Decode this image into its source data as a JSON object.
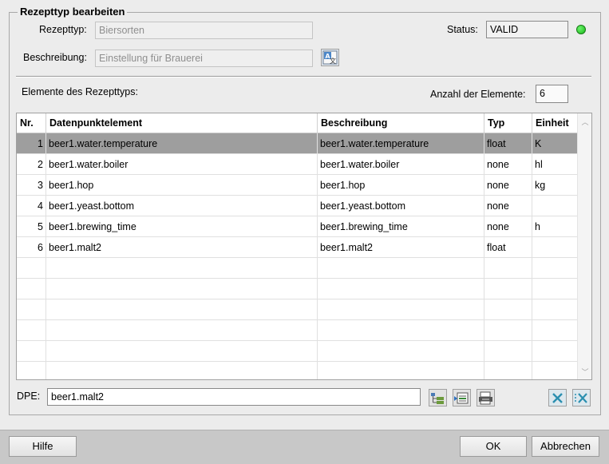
{
  "title": "Rezepttyp bearbeiten",
  "form": {
    "rezepttyp_label": "Rezepttyp:",
    "rezepttyp_value": "Biersorten",
    "beschreibung_label": "Beschreibung:",
    "beschreibung_value": "Einstellung für Brauerei",
    "status_label": "Status:",
    "status_value": "VALID",
    "status_color": "#22c322"
  },
  "elements": {
    "label": "Elemente des Rezepttyps:",
    "count_label": "Anzahl der Elemente:",
    "count_value": "6"
  },
  "table": {
    "headers": [
      "Nr.",
      "Datenpunktelement",
      "Beschreibung",
      "Typ",
      "Einheit"
    ],
    "rows": [
      [
        "1",
        "beer1.water.temperature",
        "beer1.water.temperature",
        "float",
        "K"
      ],
      [
        "2",
        "beer1.water.boiler",
        "beer1.water.boiler",
        "none",
        "hl"
      ],
      [
        "3",
        "beer1.hop",
        "beer1.hop",
        "none",
        "kg"
      ],
      [
        "4",
        "beer1.yeast.bottom",
        "beer1.yeast.bottom",
        "none",
        ""
      ],
      [
        "5",
        "beer1.brewing_time",
        "beer1.brewing_time",
        "none",
        "h"
      ],
      [
        "6",
        "beer1.malt2",
        "beer1.malt2",
        "float",
        ""
      ]
    ],
    "selected_row": 0,
    "empty_rows": 6
  },
  "dpe": {
    "label": "DPE:",
    "value": "beer1.malt2"
  },
  "icons": {
    "language": "language-translate-icon",
    "tree": "dp-tree-icon",
    "insert": "insert-element-icon",
    "replace": "replace-element-icon",
    "delete": "delete-element-icon",
    "delete_all": "delete-all-icon"
  },
  "buttons": {
    "help": "Hilfe",
    "ok": "OK",
    "cancel": "Abbrechen"
  }
}
